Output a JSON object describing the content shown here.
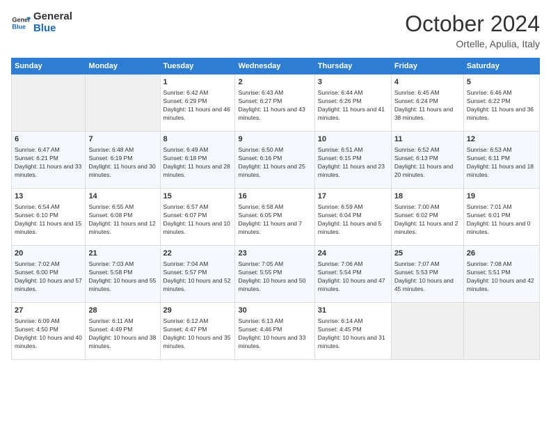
{
  "header": {
    "logo_line1": "General",
    "logo_line2": "Blue",
    "month": "October 2024",
    "location": "Ortelle, Apulia, Italy"
  },
  "weekdays": [
    "Sunday",
    "Monday",
    "Tuesday",
    "Wednesday",
    "Thursday",
    "Friday",
    "Saturday"
  ],
  "weeks": [
    [
      {
        "day": "",
        "content": ""
      },
      {
        "day": "",
        "content": ""
      },
      {
        "day": "1",
        "content": "Sunrise: 6:42 AM\nSunset: 6:29 PM\nDaylight: 11 hours and 46 minutes."
      },
      {
        "day": "2",
        "content": "Sunrise: 6:43 AM\nSunset: 6:27 PM\nDaylight: 11 hours and 43 minutes."
      },
      {
        "day": "3",
        "content": "Sunrise: 6:44 AM\nSunset: 6:26 PM\nDaylight: 11 hours and 41 minutes."
      },
      {
        "day": "4",
        "content": "Sunrise: 6:45 AM\nSunset: 6:24 PM\nDaylight: 11 hours and 38 minutes."
      },
      {
        "day": "5",
        "content": "Sunrise: 6:46 AM\nSunset: 6:22 PM\nDaylight: 11 hours and 36 minutes."
      }
    ],
    [
      {
        "day": "6",
        "content": "Sunrise: 6:47 AM\nSunset: 6:21 PM\nDaylight: 11 hours and 33 minutes."
      },
      {
        "day": "7",
        "content": "Sunrise: 6:48 AM\nSunset: 6:19 PM\nDaylight: 11 hours and 30 minutes."
      },
      {
        "day": "8",
        "content": "Sunrise: 6:49 AM\nSunset: 6:18 PM\nDaylight: 11 hours and 28 minutes."
      },
      {
        "day": "9",
        "content": "Sunrise: 6:50 AM\nSunset: 6:16 PM\nDaylight: 11 hours and 25 minutes."
      },
      {
        "day": "10",
        "content": "Sunrise: 6:51 AM\nSunset: 6:15 PM\nDaylight: 11 hours and 23 minutes."
      },
      {
        "day": "11",
        "content": "Sunrise: 6:52 AM\nSunset: 6:13 PM\nDaylight: 11 hours and 20 minutes."
      },
      {
        "day": "12",
        "content": "Sunrise: 6:53 AM\nSunset: 6:11 PM\nDaylight: 11 hours and 18 minutes."
      }
    ],
    [
      {
        "day": "13",
        "content": "Sunrise: 6:54 AM\nSunset: 6:10 PM\nDaylight: 11 hours and 15 minutes."
      },
      {
        "day": "14",
        "content": "Sunrise: 6:55 AM\nSunset: 6:08 PM\nDaylight: 11 hours and 12 minutes."
      },
      {
        "day": "15",
        "content": "Sunrise: 6:57 AM\nSunset: 6:07 PM\nDaylight: 11 hours and 10 minutes."
      },
      {
        "day": "16",
        "content": "Sunrise: 6:58 AM\nSunset: 6:05 PM\nDaylight: 11 hours and 7 minutes."
      },
      {
        "day": "17",
        "content": "Sunrise: 6:59 AM\nSunset: 6:04 PM\nDaylight: 11 hours and 5 minutes."
      },
      {
        "day": "18",
        "content": "Sunrise: 7:00 AM\nSunset: 6:02 PM\nDaylight: 11 hours and 2 minutes."
      },
      {
        "day": "19",
        "content": "Sunrise: 7:01 AM\nSunset: 6:01 PM\nDaylight: 11 hours and 0 minutes."
      }
    ],
    [
      {
        "day": "20",
        "content": "Sunrise: 7:02 AM\nSunset: 6:00 PM\nDaylight: 10 hours and 57 minutes."
      },
      {
        "day": "21",
        "content": "Sunrise: 7:03 AM\nSunset: 5:58 PM\nDaylight: 10 hours and 55 minutes."
      },
      {
        "day": "22",
        "content": "Sunrise: 7:04 AM\nSunset: 5:57 PM\nDaylight: 10 hours and 52 minutes."
      },
      {
        "day": "23",
        "content": "Sunrise: 7:05 AM\nSunset: 5:55 PM\nDaylight: 10 hours and 50 minutes."
      },
      {
        "day": "24",
        "content": "Sunrise: 7:06 AM\nSunset: 5:54 PM\nDaylight: 10 hours and 47 minutes."
      },
      {
        "day": "25",
        "content": "Sunrise: 7:07 AM\nSunset: 5:53 PM\nDaylight: 10 hours and 45 minutes."
      },
      {
        "day": "26",
        "content": "Sunrise: 7:08 AM\nSunset: 5:51 PM\nDaylight: 10 hours and 42 minutes."
      }
    ],
    [
      {
        "day": "27",
        "content": "Sunrise: 6:09 AM\nSunset: 4:50 PM\nDaylight: 10 hours and 40 minutes."
      },
      {
        "day": "28",
        "content": "Sunrise: 6:11 AM\nSunset: 4:49 PM\nDaylight: 10 hours and 38 minutes."
      },
      {
        "day": "29",
        "content": "Sunrise: 6:12 AM\nSunset: 4:47 PM\nDaylight: 10 hours and 35 minutes."
      },
      {
        "day": "30",
        "content": "Sunrise: 6:13 AM\nSunset: 4:46 PM\nDaylight: 10 hours and 33 minutes."
      },
      {
        "day": "31",
        "content": "Sunrise: 6:14 AM\nSunset: 4:45 PM\nDaylight: 10 hours and 31 minutes."
      },
      {
        "day": "",
        "content": ""
      },
      {
        "day": "",
        "content": ""
      }
    ]
  ]
}
